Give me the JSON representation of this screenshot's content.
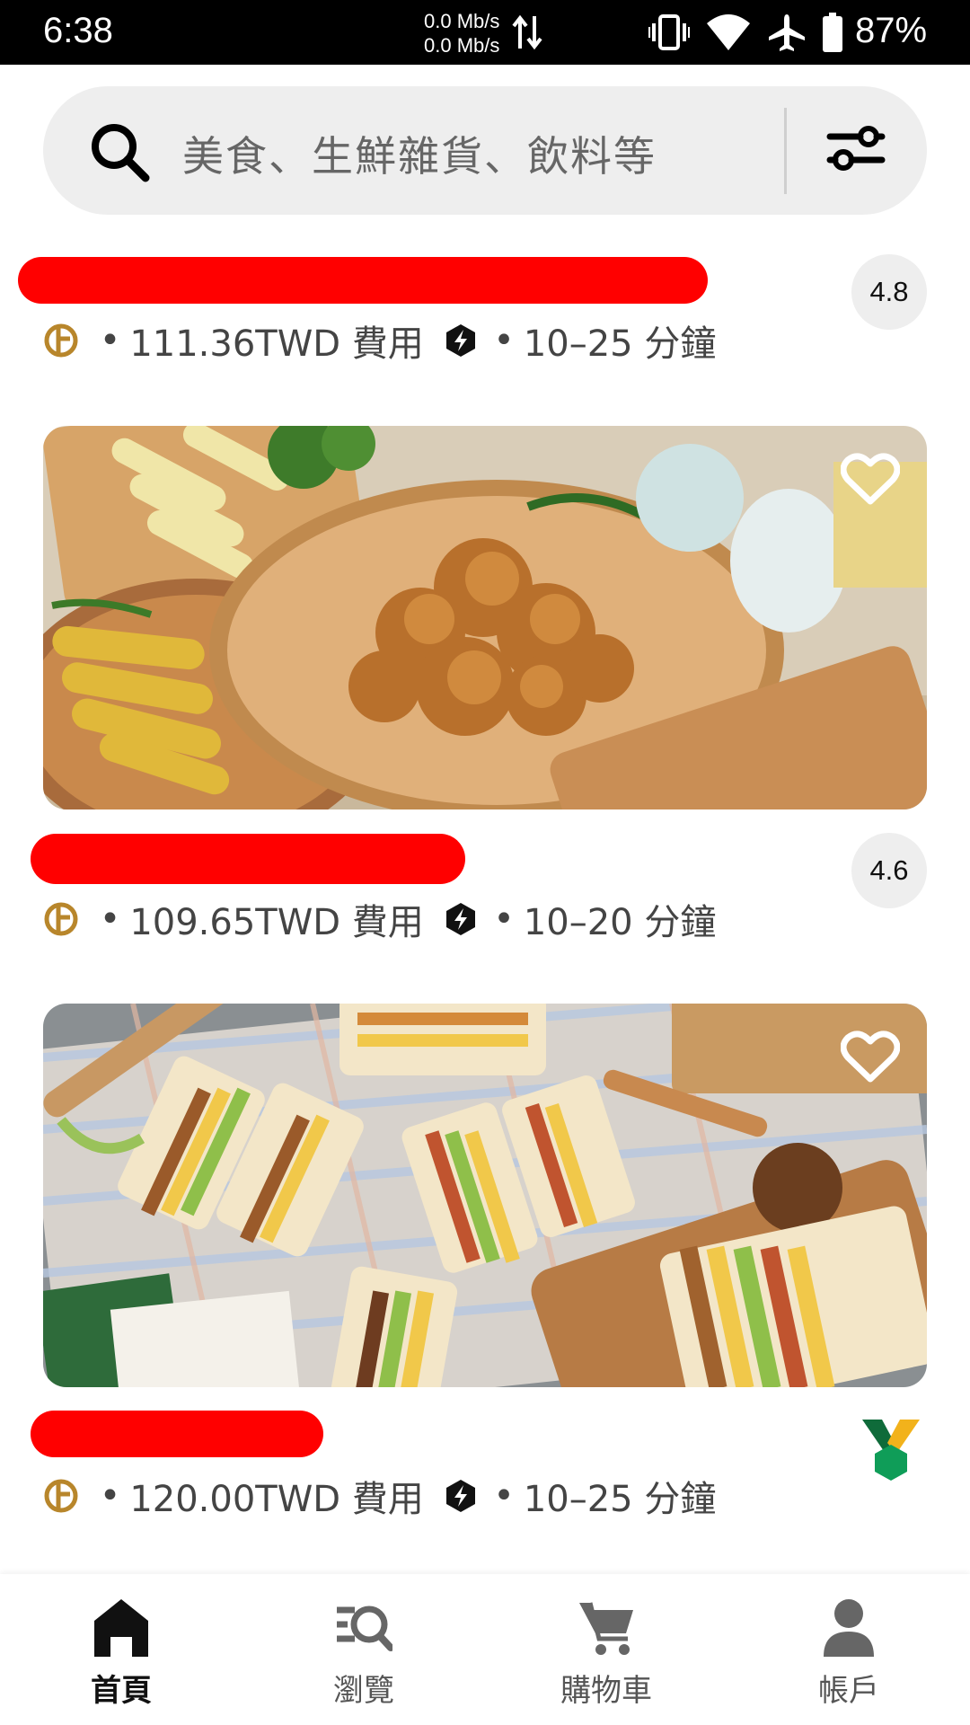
{
  "status_bar": {
    "time": "6:38",
    "net_up": "0.0 Mb/s",
    "net_down": "0.0 Mb/s",
    "battery": "87%",
    "icons": [
      "data-arrows-icon",
      "vibrate-icon",
      "wifi-icon",
      "airplane-icon",
      "battery-icon"
    ]
  },
  "search": {
    "placeholder": "美食、生鮮雜貨、飲料等",
    "icons": [
      "search-icon",
      "filter-icon"
    ]
  },
  "restaurants": [
    {
      "rating": "4.8",
      "fee": "111.36TWD 費用",
      "time": "10–25 分鐘"
    },
    {
      "rating": "4.6",
      "fee": "109.65TWD 費用",
      "time": "10–20 分鐘"
    },
    {
      "rating": "",
      "fee": "120.00TWD 費用",
      "time": "10–25 分鐘",
      "badge": "medal-icon"
    }
  ],
  "colors": {
    "redaction": "#ff0000",
    "meta_icon": "#b8862b",
    "brand_green": "#0f9d58",
    "medal_ribbon": "#f2b21b"
  },
  "nav": [
    {
      "label": "首頁",
      "icon": "home-icon",
      "active": true
    },
    {
      "label": "瀏覽",
      "icon": "browse-icon",
      "active": false
    },
    {
      "label": "購物車",
      "icon": "cart-icon",
      "active": false
    },
    {
      "label": "帳戶",
      "icon": "account-icon",
      "active": false
    }
  ]
}
